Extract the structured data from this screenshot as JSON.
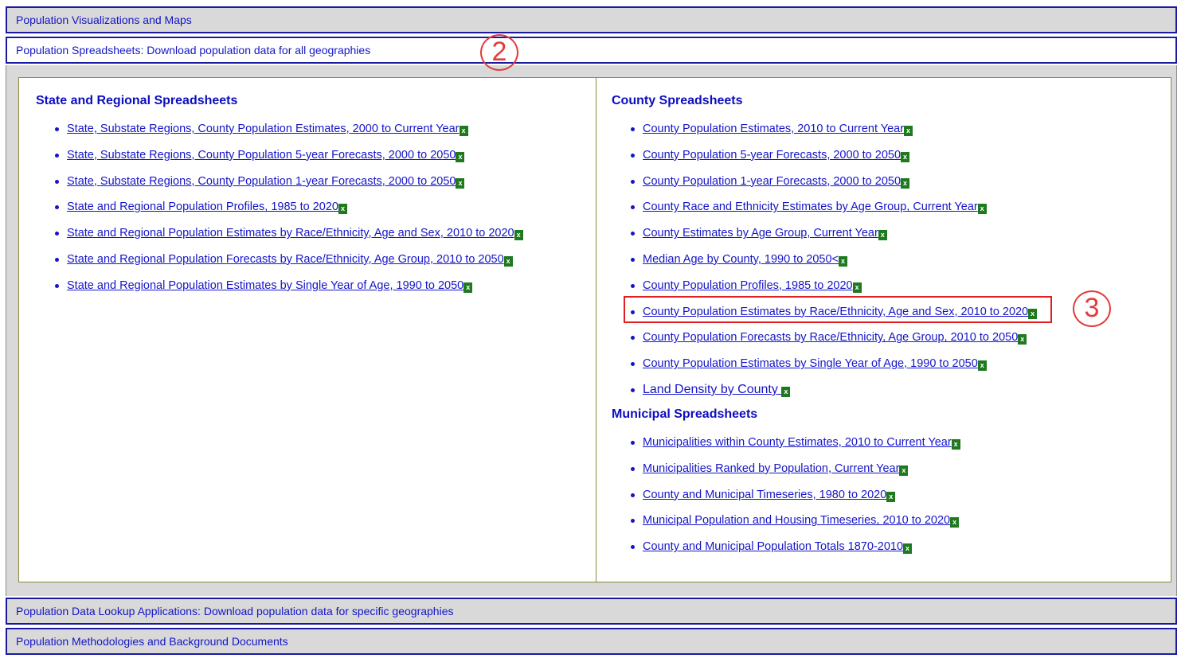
{
  "accordion": {
    "viz_label": "Population Visualizations and Maps",
    "spreadsheets_label": "Population Spreadsheets: Download population data for all geographies",
    "lookup_label": "Population Data Lookup Applications: Download population data for specific geographies",
    "methodologies_label": "Population Methodologies and Background Documents"
  },
  "state_regional": {
    "title": "State and Regional Spreadsheets",
    "links": [
      "State, Substate Regions, County Population Estimates, 2000 to Current Year",
      "State, Substate Regions, County Population 5-year Forecasts, 2000 to 2050",
      "State, Substate Regions, County Population 1-year Forecasts, 2000 to 2050",
      "State and Regional Population Profiles, 1985 to 2020",
      "State and Regional Population Estimates by Race/Ethnicity, Age and Sex, 2010 to 2020",
      "State and Regional Population Forecasts by Race/Ethnicity, Age Group, 2010 to 2050",
      "State and Regional Population Estimates by Single Year of Age, 1990 to 2050"
    ]
  },
  "county": {
    "title": "County Spreadsheets",
    "links": [
      "County Population Estimates, 2010 to Current Year",
      "County Population 5-year Forecasts, 2000 to 2050",
      "County Population 1-year Forecasts, 2000 to 2050",
      "County Race and Ethnicity Estimates by Age Group, Current Year",
      "County Estimates by Age Group, Current Year",
      "Median Age by County, 1990 to 2050<",
      "County Population Profiles, 1985 to 2020",
      "County Population Estimates by Race/Ethnicity, Age and Sex, 2010 to 2020",
      "County Population Forecasts by Race/Ethnicity, Age Group, 2010 to 2050",
      "County Population Estimates by Single Year of Age, 1990 to 2050",
      "Land Density by County "
    ]
  },
  "municipal": {
    "title": "Municipal Spreadsheets",
    "links": [
      "Municipalities within County Estimates, 2010 to Current Year",
      "Municipalities Ranked by Population, Current Year",
      "County and Municipal Timeseries, 1980 to 2020",
      "Municipal Population and Housing Timeseries, 2010 to 2020",
      "County and Municipal Population Totals 1870-2010"
    ]
  },
  "icons": {
    "excel_icon": "excel-file-icon",
    "excel_glyph": "x"
  },
  "annotations": {
    "marker_2": "2",
    "marker_3": "3",
    "marker_color": "#e23c3c"
  },
  "colors": {
    "link": "#1515c8",
    "heading": "#0d0dbf",
    "header_bg": "#d9d9d9",
    "excel_green": "#1f7a1f"
  }
}
